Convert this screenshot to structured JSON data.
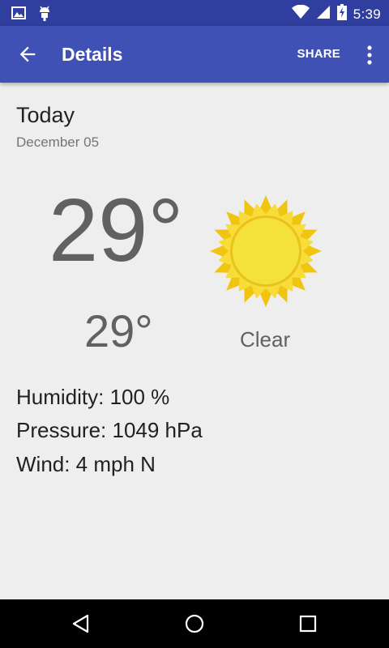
{
  "status_bar": {
    "time": "5:39",
    "icons": [
      "image-notification-icon",
      "android-debug-icon",
      "wifi-icon",
      "cell-signal-icon",
      "battery-charging-icon"
    ]
  },
  "app_bar": {
    "title": "Details",
    "share_label": "SHARE",
    "back_icon": "arrow-back-icon",
    "overflow_icon": "more-vert-icon",
    "color": "#3f51b5"
  },
  "forecast": {
    "day": "Today",
    "date": "December 05",
    "high": "29°",
    "low": "29°",
    "condition": "Clear",
    "icon": "sun-icon",
    "humidity": "Humidity: 100 %",
    "pressure": "Pressure: 1049 hPa",
    "wind": "Wind: 4 mph N"
  },
  "nav_bar": {
    "icons": [
      "nav-back-icon",
      "nav-home-icon",
      "nav-recents-icon"
    ]
  }
}
